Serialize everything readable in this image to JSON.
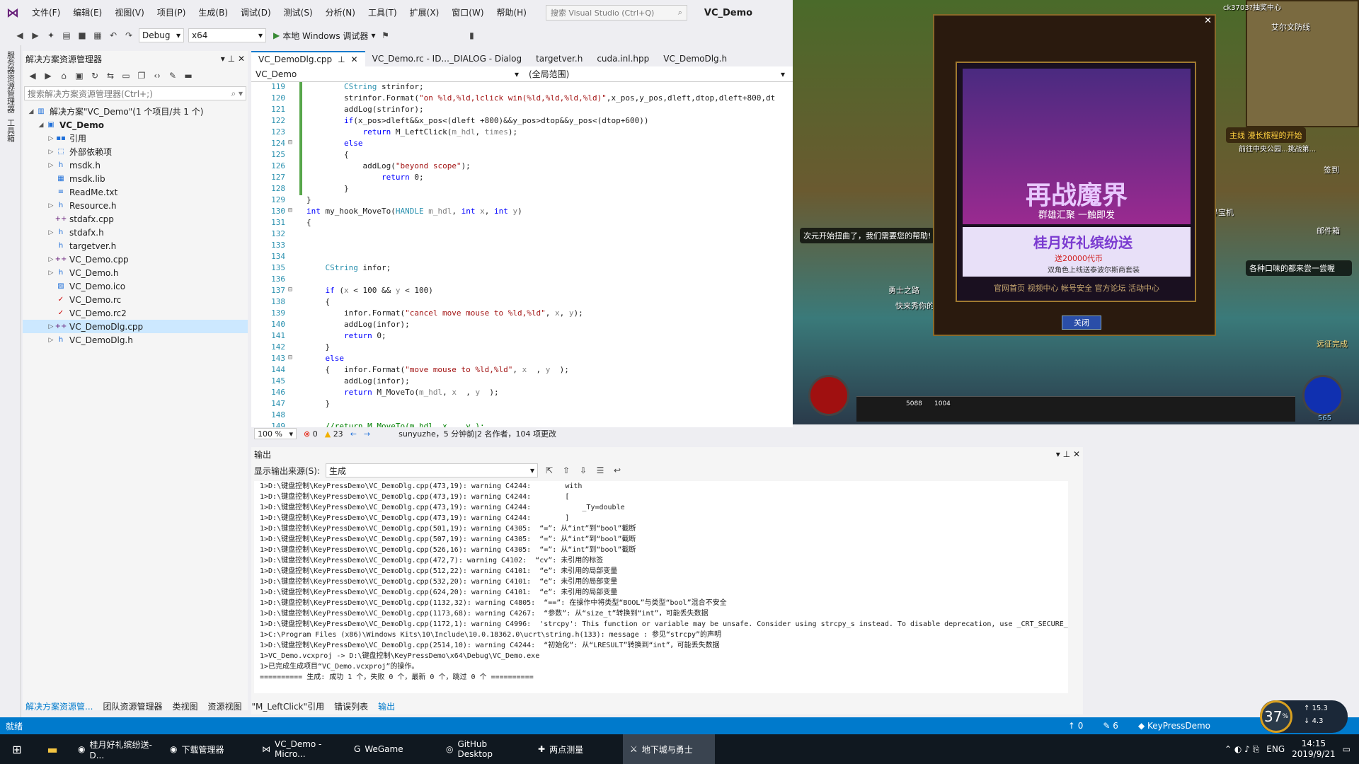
{
  "menu": {
    "items": [
      "文件(F)",
      "编辑(E)",
      "视图(V)",
      "项目(P)",
      "生成(B)",
      "调试(D)",
      "测试(S)",
      "分析(N)",
      "工具(T)",
      "扩展(X)",
      "窗口(W)",
      "帮助(H)"
    ],
    "search_placeholder": "搜索 Visual Studio (Ctrl+Q)",
    "project_title": "VC_Demo"
  },
  "toolbar": {
    "config": "Debug",
    "platform": "x64",
    "run_label": "本地 Windows 调试器"
  },
  "rail": {
    "labels": [
      "服务器资源管理器",
      "工具箱"
    ]
  },
  "solution_explorer": {
    "title": "解决方案资源管理器",
    "search_placeholder": "搜索解决方案资源管理器(Ctrl+;)",
    "items": [
      {
        "label": "解决方案\"VC_Demo\"(1 个项目/共 1 个)",
        "indent": 0,
        "arrow": "◢",
        "icon": "solution-icon"
      },
      {
        "label": "VC_Demo",
        "indent": 1,
        "arrow": "◢",
        "icon": "project-icon",
        "bold": true
      },
      {
        "label": "引用",
        "indent": 2,
        "arrow": "▷",
        "icon": "references-icon"
      },
      {
        "label": "外部依赖项",
        "indent": 2,
        "arrow": "▷",
        "icon": "external-deps-icon"
      },
      {
        "label": "msdk.h",
        "indent": 2,
        "arrow": "▷",
        "icon": "header-file-icon"
      },
      {
        "label": "msdk.lib",
        "indent": 2,
        "arrow": "",
        "icon": "lib-file-icon"
      },
      {
        "label": "ReadMe.txt",
        "indent": 2,
        "arrow": "",
        "icon": "text-file-icon"
      },
      {
        "label": "Resource.h",
        "indent": 2,
        "arrow": "▷",
        "icon": "header-file-icon"
      },
      {
        "label": "stdafx.cpp",
        "indent": 2,
        "arrow": "",
        "icon": "cpp-file-icon"
      },
      {
        "label": "stdafx.h",
        "indent": 2,
        "arrow": "▷",
        "icon": "header-file-icon"
      },
      {
        "label": "targetver.h",
        "indent": 2,
        "arrow": "",
        "icon": "header-file-icon"
      },
      {
        "label": "VC_Demo.cpp",
        "indent": 2,
        "arrow": "▷",
        "icon": "cpp-file-icon"
      },
      {
        "label": "VC_Demo.h",
        "indent": 2,
        "arrow": "▷",
        "icon": "header-file-icon"
      },
      {
        "label": "VC_Demo.ico",
        "indent": 2,
        "arrow": "",
        "icon": "ico-file-icon"
      },
      {
        "label": "VC_Demo.rc",
        "indent": 2,
        "arrow": "",
        "icon": "rc-file-icon"
      },
      {
        "label": "VC_Demo.rc2",
        "indent": 2,
        "arrow": "",
        "icon": "rc-file-icon"
      },
      {
        "label": "VC_DemoDlg.cpp",
        "indent": 2,
        "arrow": "▷",
        "icon": "cpp-file-icon",
        "selected": true
      },
      {
        "label": "VC_DemoDlg.h",
        "indent": 2,
        "arrow": "▷",
        "icon": "header-file-icon"
      }
    ]
  },
  "editor": {
    "tabs": [
      "VC_DemoDlg.cpp",
      "VC_Demo.rc - ID..._DIALOG - Dialog",
      "targetver.h",
      "cuda.inl.hpp",
      "VC_DemoDlg.h"
    ],
    "nav_project": "VC_Demo",
    "nav_scope": "(全局范围)",
    "lines": [
      {
        "n": "119",
        "html": "        <span class=\"ty\">CString</span> strinfor;",
        "chg": true
      },
      {
        "n": "120",
        "html": "        strinfor.Format(<span class=\"str\">\"on %ld,%ld,lclick win(%ld,%ld,%ld,%ld)\"</span>,x_pos,y_pos,dleft,dtop,dleft+800,dt",
        "chg": true
      },
      {
        "n": "121",
        "html": "        addLog(strinfor);",
        "chg": true
      },
      {
        "n": "122",
        "html": "        <span class=\"kw\">if</span>(x_pos&gt;dleft&amp;&amp;x_pos&lt;(dleft +800)&amp;&amp;y_pos&gt;dtop&amp;&amp;y_pos&lt;(dtop+600))",
        "chg": true
      },
      {
        "n": "123",
        "html": "            <span class=\"kw\">return</span> M_LeftClick(<span class=\"pa\">m_hdl</span>, <span class=\"pa\">times</span>);",
        "chg": true
      },
      {
        "n": "124",
        "html": "        <span class=\"kw\">else</span>",
        "chg": true,
        "fold": true
      },
      {
        "n": "125",
        "html": "        {",
        "chg": true
      },
      {
        "n": "126",
        "html": "            addLog(<span class=\"str\">\"beyond scope\"</span>);",
        "chg": true
      },
      {
        "n": "127",
        "html": "                <span class=\"kw\">return</span> 0;",
        "chg": true
      },
      {
        "n": "128",
        "html": "        }",
        "chg": true
      },
      {
        "n": "129",
        "html": "}",
        "chg": false
      },
      {
        "n": "130",
        "html": "<span class=\"kw\">int</span> my_hook_MoveTo(<span class=\"ty\">HANDLE</span> <span class=\"pa\">m_hdl</span>, <span class=\"kw\">int</span> <span class=\"pa\">x</span>, <span class=\"kw\">int</span> <span class=\"pa\">y</span>)",
        "chg": false,
        "fold": true
      },
      {
        "n": "131",
        "html": "{",
        "chg": false
      },
      {
        "n": "132",
        "html": "",
        "chg": false
      },
      {
        "n": "133",
        "html": "",
        "chg": false
      },
      {
        "n": "134",
        "html": "",
        "chg": false
      },
      {
        "n": "135",
        "html": "    <span class=\"ty\">CString</span> infor;",
        "chg": false
      },
      {
        "n": "136",
        "html": "",
        "chg": false
      },
      {
        "n": "137",
        "html": "    <span class=\"kw\">if</span> (<span class=\"pa\">x</span> &lt; 100 &amp;&amp; <span class=\"pa\">y</span> &lt; 100)",
        "chg": false,
        "fold": true
      },
      {
        "n": "138",
        "html": "    {",
        "chg": false
      },
      {
        "n": "139",
        "html": "        infor.Format(<span class=\"str\">\"cancel move mouse to %ld,%ld\"</span>, <span class=\"pa\">x</span>, <span class=\"pa\">y</span>);",
        "chg": false
      },
      {
        "n": "140",
        "html": "        addLog(infor);",
        "chg": false
      },
      {
        "n": "141",
        "html": "        <span class=\"kw\">return</span> 0;",
        "chg": false
      },
      {
        "n": "142",
        "html": "    }",
        "chg": false
      },
      {
        "n": "143",
        "html": "    <span class=\"kw\">else</span>",
        "chg": false,
        "fold": true
      },
      {
        "n": "144",
        "html": "    {   infor.Format(<span class=\"str\">\"move mouse to %ld,%ld\"</span>, <span class=\"pa\">x</span>  , <span class=\"pa\">y</span>  );",
        "chg": false
      },
      {
        "n": "145",
        "html": "        addLog(infor);",
        "chg": false
      },
      {
        "n": "146",
        "html": "        <span class=\"kw\">return</span> M_MoveTo(<span class=\"pa\">m_hdl</span>, <span class=\"pa\">x</span>  , <span class=\"pa\">y</span>  );",
        "chg": false
      },
      {
        "n": "147",
        "html": "    }",
        "chg": false
      },
      {
        "n": "148",
        "html": "",
        "chg": false
      },
      {
        "n": "149",
        "html": "    <span class=\"cm\">//return M_MoveTo(m_hdl, x  , y );</span>",
        "chg": false
      }
    ],
    "zoom": "100 %",
    "errors": "0",
    "warnings": "23",
    "blame": "sunyuzhe，5 分钟前|2 名作者，104 项更改"
  },
  "output": {
    "title": "输出",
    "source_label": "显示输出来源(S):",
    "source_value": "生成",
    "lines": [
      "1>D:\\键盘控制\\KeyPressDemo\\VC_DemoDlg.cpp(473,19): warning C4244:        with",
      "1>D:\\键盘控制\\KeyPressDemo\\VC_DemoDlg.cpp(473,19): warning C4244:        [",
      "1>D:\\键盘控制\\KeyPressDemo\\VC_DemoDlg.cpp(473,19): warning C4244:            _Ty=double",
      "1>D:\\键盘控制\\KeyPressDemo\\VC_DemoDlg.cpp(473,19): warning C4244:        ]",
      "1>D:\\键盘控制\\KeyPressDemo\\VC_DemoDlg.cpp(501,19): warning C4305:  “=”: 从“int”到“bool”截断",
      "1>D:\\键盘控制\\KeyPressDemo\\VC_DemoDlg.cpp(507,19): warning C4305:  “=”: 从“int”到“bool”截断",
      "1>D:\\键盘控制\\KeyPressDemo\\VC_DemoDlg.cpp(526,16): warning C4305:  “=”: 从“int”到“bool”截断",
      "1>D:\\键盘控制\\KeyPressDemo\\VC_DemoDlg.cpp(472,7): warning C4102:  “cv”: 未引用的标签",
      "1>D:\\键盘控制\\KeyPressDemo\\VC_DemoDlg.cpp(512,22): warning C4101:  “e”: 未引用的局部变量",
      "1>D:\\键盘控制\\KeyPressDemo\\VC_DemoDlg.cpp(532,20): warning C4101:  “e”: 未引用的局部变量",
      "1>D:\\键盘控制\\KeyPressDemo\\VC_DemoDlg.cpp(624,20): warning C4101:  “e”: 未引用的局部变量",
      "1>D:\\键盘控制\\KeyPressDemo\\VC_DemoDlg.cpp(1132,32): warning C4805:  “==”: 在操作中将类型“BOOL”与类型“bool”混合不安全",
      "1>D:\\键盘控制\\KeyPressDemo\\VC_DemoDlg.cpp(1173,68): warning C4267:  “参数”: 从“size_t”转换到“int”，可能丢失数据",
      "1>D:\\键盘控制\\KeyPressDemo\\VC_DemoDlg.cpp(1172,1): warning C4996:  'strcpy': This function or variable may be unsafe. Consider using strcpy_s instead. To disable deprecation, use _CRT_SECURE_",
      "1>C:\\Program Files (x86)\\Windows Kits\\10\\Include\\10.0.18362.0\\ucrt\\string.h(133): message : 参见“strcpy”的声明",
      "1>D:\\键盘控制\\KeyPressDemo\\VC_DemoDlg.cpp(2514,10): warning C4244:  “初始化”: 从“LRESULT”转换到“int”，可能丢失数据",
      "1>VC_Demo.vcxproj -> D:\\键盘控制\\KeyPressDemo\\x64\\Debug\\VC_Demo.exe",
      "1>已完成生成项目“VC_Demo.vcxproj”的操作。",
      "========== 生成: 成功 1 个，失败 0 个，最新 0 个，跳过 0 个 =========="
    ]
  },
  "bottom_tabs": [
    "解决方案资源管...",
    "团队资源管理器",
    "类视图",
    "资源视图",
    "\"M_LeftClick\"引用",
    "错误列表",
    "输出"
  ],
  "statusbar": {
    "ready": "就绪",
    "up": "0",
    "edits": "6",
    "repo": "KeyPressDemo"
  },
  "taskbar": {
    "apps": [
      "桂月好礼缤纷送-D...",
      "下载管理器",
      "VC_Demo - Micro...",
      "WeGame",
      "GitHub Desktop",
      "两点测量",
      "地下城与勇士"
    ],
    "lang": "ENG",
    "time": "14:15",
    "date": "2019/9/21"
  },
  "net_widget": {
    "cpu": "37",
    "up": "15.3",
    "down": "4.3"
  },
  "game": {
    "popup_title_big": "再战魔界",
    "popup_sub": "群雄汇聚  一触即发",
    "ad_title": "桂月好礼缤纷送",
    "ad_line1": "送20000代币",
    "ad_line2": "双角色上线送泰波尔斯商套装",
    "links": "官网首页  视频中心  帐号安全  官方论坛  活动中心",
    "close_btn": "关闭",
    "player_name": "ck3703?抽奖中心",
    "npc_label": "艾尔文防线",
    "quest": "主线 漫长旅程的开始",
    "quest2": "前往中央公园...挑战第...",
    "hint_bubble": "次元开始扭曲了，我们需要您的帮助!",
    "hero_label": "勇士之路",
    "show_label": "快来秀你的",
    "treasure": "寻宝机",
    "mail": "邮件箱",
    "sign": "签到",
    "bubble2": "各种口味的都来尝一尝喔",
    "complete": "远征完成",
    "hp_count": "5088",
    "mp_count": "1004",
    "level": "565"
  }
}
